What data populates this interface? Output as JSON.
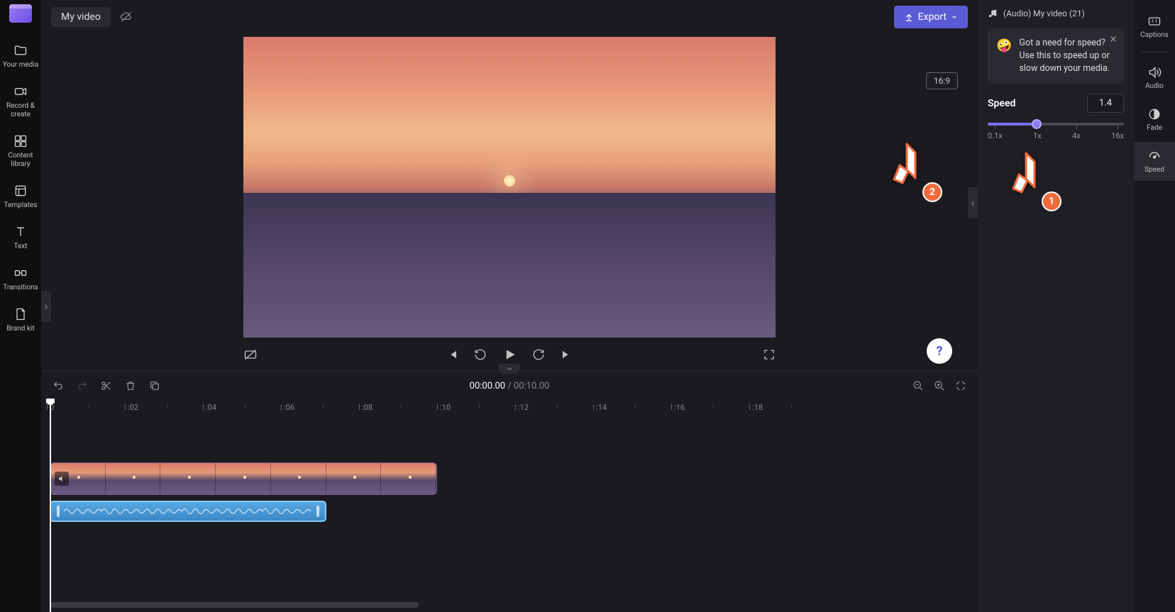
{
  "header": {
    "title": "My video",
    "export_label": "Export"
  },
  "left_nav": {
    "items": [
      {
        "label": "Your media"
      },
      {
        "label": "Record &\ncreate"
      },
      {
        "label": "Content\nlibrary"
      },
      {
        "label": "Templates"
      },
      {
        "label": "Text"
      },
      {
        "label": "Transitions"
      },
      {
        "label": "Brand kit"
      }
    ]
  },
  "preview": {
    "aspect_badge": "16:9"
  },
  "timeline": {
    "current_time": "00:00.00",
    "total_time": "00:10.00",
    "ruler": [
      "0",
      ":02",
      ":04",
      ":06",
      ":08",
      ":10",
      ":12",
      ":14",
      ":16",
      ":18"
    ]
  },
  "inspector": {
    "clip_title": "(Audio) My video (21)",
    "tip": "Got a need for speed? Use this to speed up or slow down your media.",
    "speed_label": "Speed",
    "speed_value": "1.4",
    "slider_ticks": [
      "0.1x",
      "1x",
      "4x",
      "16x"
    ]
  },
  "tool_rail": {
    "items": [
      {
        "label": "Captions"
      },
      {
        "label": "Audio"
      },
      {
        "label": "Fade"
      },
      {
        "label": "Speed"
      }
    ]
  },
  "pointers": {
    "p1": "1",
    "p2": "2"
  },
  "help": "?"
}
